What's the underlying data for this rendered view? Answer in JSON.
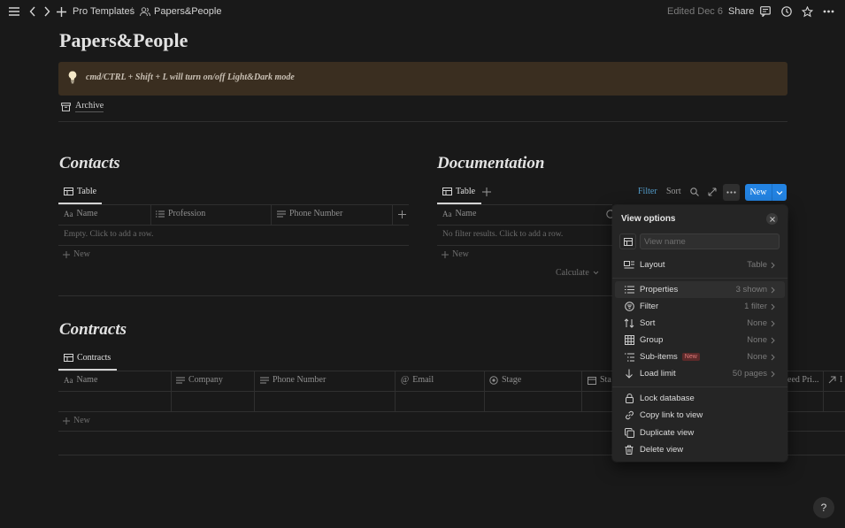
{
  "topbar": {
    "breadcrumb_1": "Pro Templates",
    "separator": "/",
    "breadcrumb_2": "Papers&People",
    "edited": "Edited Dec 6",
    "share": "Share"
  },
  "page": {
    "title": "Papers&People",
    "callout": "cmd/CTRL + Shift + L will turn on/off Light&Dark mode",
    "archive": "Archive"
  },
  "contacts": {
    "title": "Contacts",
    "tab": "Table",
    "columns": [
      "Name",
      "Profession",
      "Phone Number"
    ],
    "empty": "Empty. Click to add a row.",
    "new": "New"
  },
  "documentation": {
    "title": "Documentation",
    "tab": "Table",
    "columns": [
      "Name"
    ],
    "empty": "No filter results. Click to add a row.",
    "new": "New",
    "calculate": "Calculate",
    "toolbar": {
      "filter": "Filter",
      "sort": "Sort",
      "new": "New"
    }
  },
  "contracts": {
    "title": "Contracts",
    "tab": "Contracts",
    "columns": [
      "Name",
      "Company",
      "Phone Number",
      "Email",
      "Stage",
      "Sta",
      "eed Pri...",
      "I"
    ],
    "new": "New"
  },
  "view_options": {
    "title": "View options",
    "view_name_placeholder": "View name",
    "layout": {
      "label": "Layout",
      "value": "Table"
    },
    "items": [
      {
        "label": "Properties",
        "value": "3 shown",
        "icon": "list-icon"
      },
      {
        "label": "Filter",
        "value": "1 filter",
        "icon": "filter-icon"
      },
      {
        "label": "Sort",
        "value": "None",
        "icon": "sort-icon"
      },
      {
        "label": "Group",
        "value": "None",
        "icon": "group-icon"
      },
      {
        "label": "Sub-items",
        "value": "None",
        "icon": "sub-items-icon",
        "badge": "New"
      },
      {
        "label": "Load limit",
        "value": "50 pages",
        "icon": "arrow-down-icon"
      }
    ],
    "actions": [
      {
        "label": "Lock database",
        "icon": "lock-icon"
      },
      {
        "label": "Copy link to view",
        "icon": "link-icon"
      },
      {
        "label": "Duplicate view",
        "icon": "duplicate-icon"
      },
      {
        "label": "Delete view",
        "icon": "trash-icon"
      }
    ]
  },
  "help": "?",
  "colors": {
    "background": "#191919",
    "accent": "#2383e2",
    "callout": "#3a2e20",
    "popup": "#252525"
  }
}
